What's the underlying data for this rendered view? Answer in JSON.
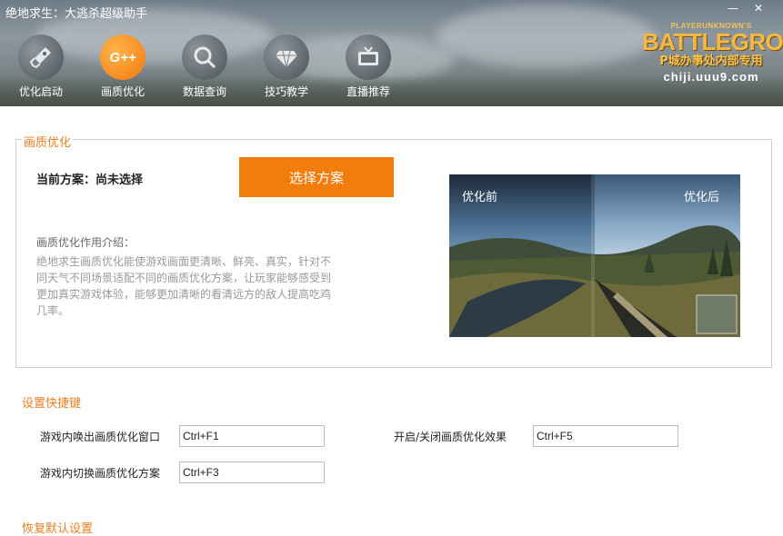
{
  "header": {
    "title": "绝地求生：大逃杀超级助手",
    "window_controls": {
      "minimize": "—",
      "close": "✕"
    },
    "nav": [
      {
        "label": "优化启动",
        "icon": "rocket-icon"
      },
      {
        "label": "画质优化",
        "icon": "g-plus-icon",
        "icon_text": "G++",
        "active": true
      },
      {
        "label": "数据查询",
        "icon": "search-icon"
      },
      {
        "label": "技巧教学",
        "icon": "diamond-icon"
      },
      {
        "label": "直播推荐",
        "icon": "tv-icon"
      }
    ],
    "logo": {
      "small": "PLAYERUNKNOWN'S",
      "main": "BATTLEGROUNDS",
      "sub": "P城办事处内部专用",
      "url": "chiji.uuu9.com"
    }
  },
  "quality": {
    "legend": "画质优化",
    "current_plan": "当前方案：尚未选择",
    "select_button": "选择方案",
    "intro_title": "画质优化作用介绍：",
    "intro_body": "绝地求生画质优化能使游戏画面更清晰、鲜亮、真实，针对不同天气不同场景适配不同的画质优化方案，让玩家能够感受到更加真实游戏体验，能够更加清晰的看清远方的敌人提高吃鸡几率。",
    "preview": {
      "before_label": "优化前",
      "after_label": "优化后"
    }
  },
  "hotkeys": {
    "title": "设置快捷键",
    "items": [
      {
        "label": "游戏内唤出画质优化窗口",
        "value": "Ctrl+F1"
      },
      {
        "label": "开启/关闭画质优化效果",
        "value": "Ctrl+F5"
      },
      {
        "label": "游戏内切换画质优化方案",
        "value": "Ctrl+F3"
      }
    ]
  },
  "restore": {
    "title": "恢复默认设置"
  },
  "colors": {
    "accent": "#f07d0c",
    "section_title": "#e67e22"
  }
}
